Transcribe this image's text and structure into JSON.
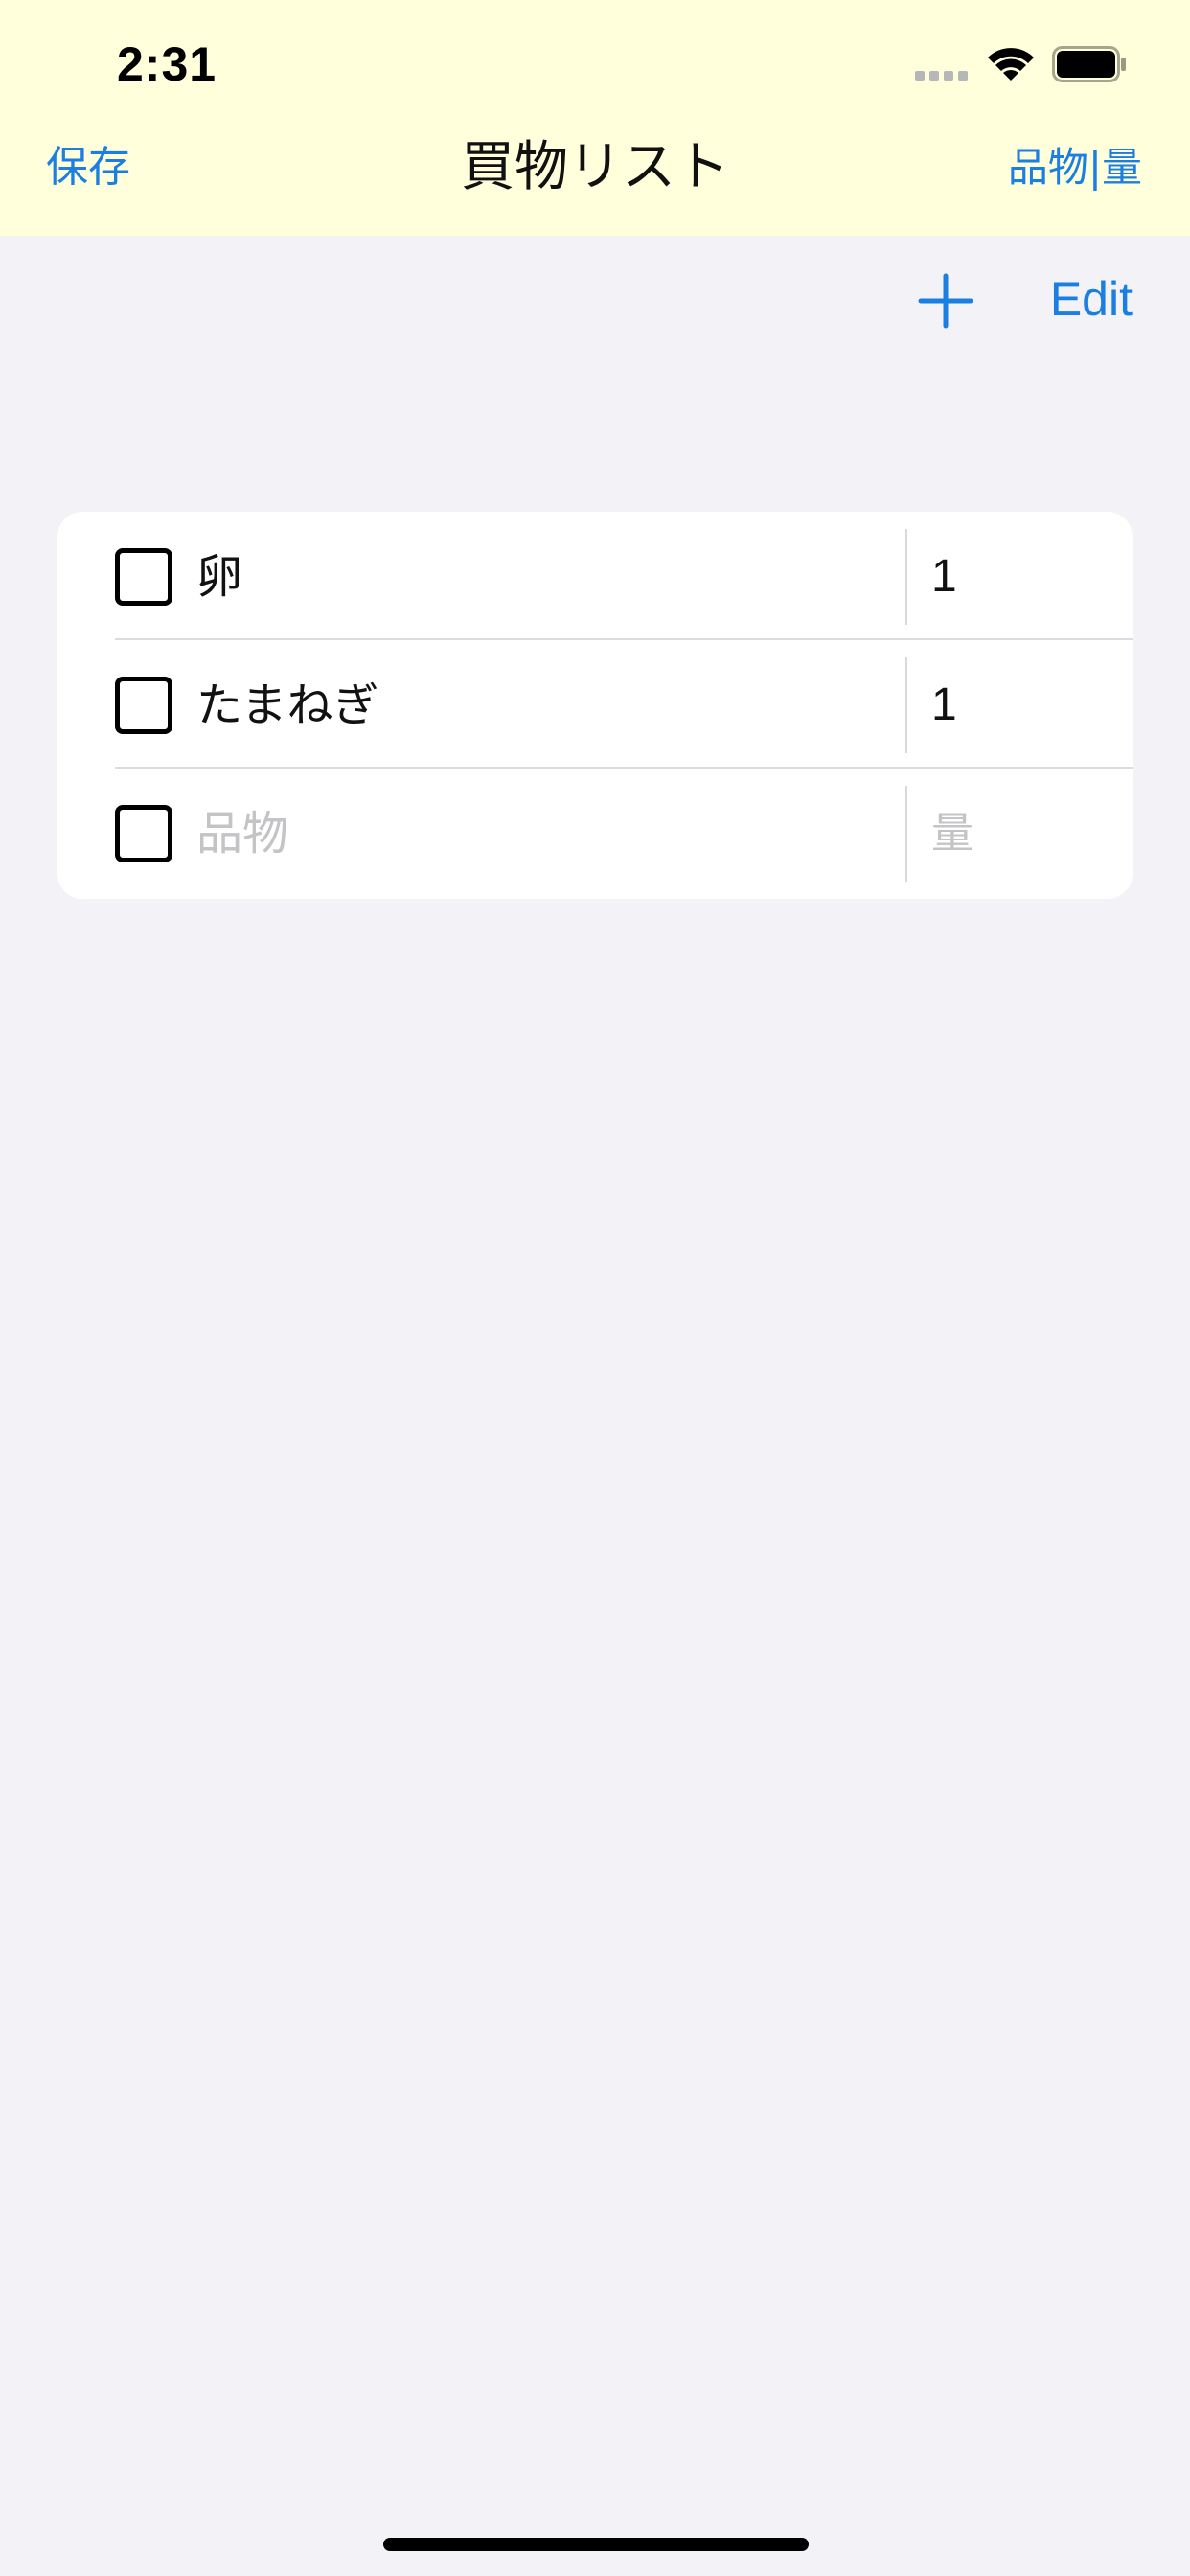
{
  "status_bar": {
    "time": "2:31",
    "icons": [
      "cellular-signal-icon",
      "wifi-icon",
      "battery-icon"
    ]
  },
  "nav": {
    "left_label": "保存",
    "title": "買物リスト",
    "right_label": "品物|量"
  },
  "toolbar": {
    "add_icon": "plus-icon",
    "edit_label": "Edit"
  },
  "list": {
    "items": [
      {
        "name": "卵",
        "quantity": "1",
        "checked": false
      },
      {
        "name": "たまねぎ",
        "quantity": "1",
        "checked": false
      }
    ],
    "new_item": {
      "name_placeholder": "品物",
      "quantity_placeholder": "量",
      "checked": false
    }
  },
  "colors": {
    "accent": "#1a7fe0",
    "top_background": "#ffffdc",
    "page_background": "#f2f2f7",
    "placeholder": "#c4c4c7"
  }
}
